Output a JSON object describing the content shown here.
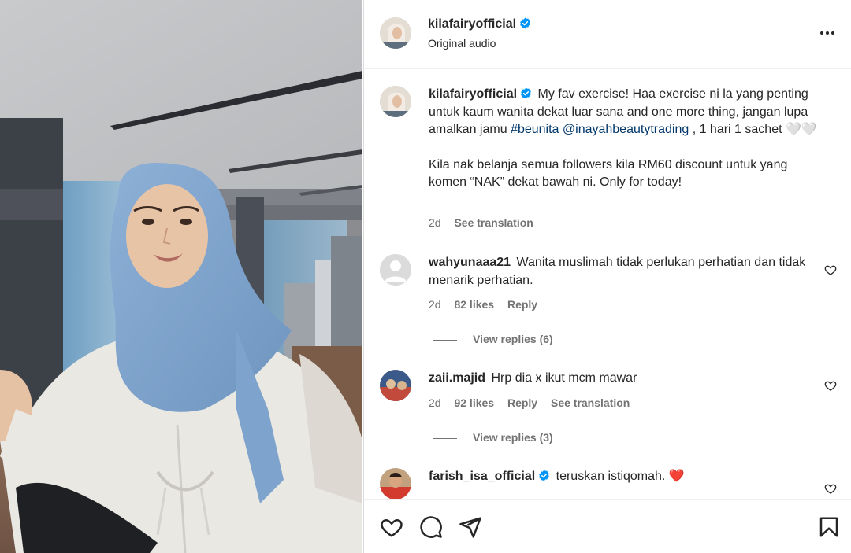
{
  "post": {
    "username": "kilafairyofficial",
    "audio": "Original audio",
    "caption": {
      "text_a": "My fav exercise! Haa exercise ni la yang penting untuk kaum wanita dekat luar sana and one more thing, jangan lupa amalkan jamu ",
      "hashtag": "#beunita",
      "mention": "@inayahbeautytrading",
      "text_b": " , 1 hari 1 sachet 🤍🤍",
      "para2": "Kila nak belanja semua followers kila RM60 discount untuk yang komen “NAK” dekat bawah ni. Only for today!",
      "age": "2d",
      "see_translation": "See translation"
    }
  },
  "comments": [
    {
      "username": "wahyunaaa21",
      "text": "Wanita muslimah tidak perlukan perhatian dan tidak menarik perhatian.",
      "age": "2d",
      "likes": "82 likes",
      "reply": "Reply",
      "view_replies": "View replies (6)"
    },
    {
      "username": "zaii.majid",
      "text": "Hrp dia x ikut mcm mawar",
      "age": "2d",
      "likes": "92 likes",
      "reply": "Reply",
      "see_translation": "See translation",
      "view_replies": "View replies (3)"
    },
    {
      "username": "farish_isa_official",
      "text": "teruskan istiqomah. ❤️"
    }
  ],
  "icons": {
    "more": "more-options-icon",
    "like": "heart-icon",
    "comment": "comment-icon",
    "share": "share-icon",
    "save": "bookmark-icon",
    "verified": "verified-badge-icon"
  },
  "colors": {
    "verified_blue": "#0095f6",
    "link": "#00376b",
    "heart_red": "#ed4956"
  }
}
